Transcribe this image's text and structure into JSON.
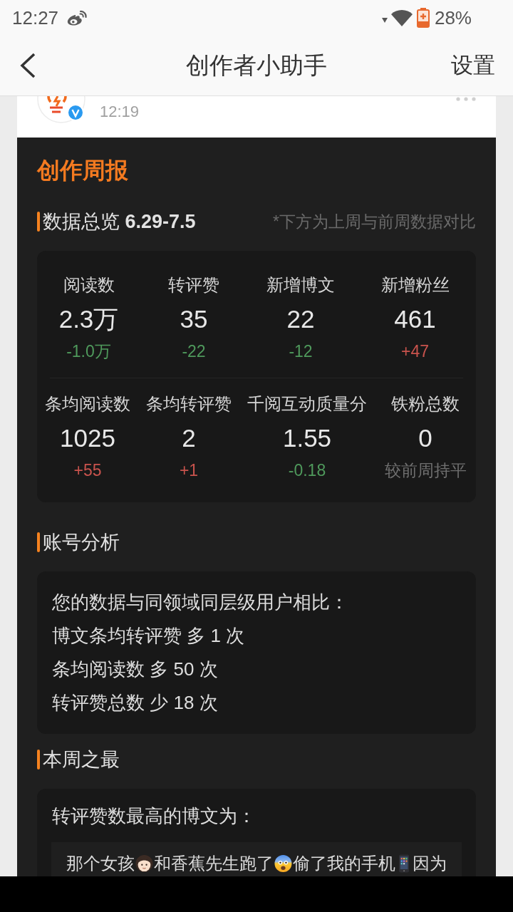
{
  "status_bar": {
    "time": "12:27",
    "battery": "28%"
  },
  "nav_bar": {
    "title": "创作者小助手",
    "action": "设置"
  },
  "post": {
    "time": "12:19"
  },
  "report": {
    "title": "创作周报",
    "overview": {
      "heading": "数据总览 **6.29-7.5**",
      "note": "*下方为上周与前周数据对比",
      "rows": [
        {
          "items": [
            {
              "label": "阅读数",
              "value": "2.3万",
              "change": "-1.0万",
              "color": "#4f9a5c"
            },
            {
              "label": "转评赞",
              "value": "35",
              "change": "-22",
              "color": "#4f9a5c"
            },
            {
              "label": "新增博文",
              "value": "22",
              "change": "-12",
              "color": "#4f9a5c"
            },
            {
              "label": "新增粉丝",
              "value": "461",
              "change": "+47",
              "color": "#c9534d"
            }
          ]
        },
        {
          "items": [
            {
              "label": "条均阅读数",
              "value": "1025",
              "change": "+55",
              "color": "#c9534d"
            },
            {
              "label": "条均转评赞",
              "value": "2",
              "change": "+1",
              "color": "#c9534d"
            },
            {
              "label": "千阅互动质量分",
              "value": "1.55",
              "change": "-0.18",
              "color": "#4f9a5c"
            },
            {
              "label": "铁粉总数",
              "value": "0",
              "change": "较前周持平",
              "color": "#6f6f6f"
            }
          ]
        }
      ]
    },
    "analysis": {
      "heading": "账号分析",
      "lines": [
        "您的数据与同领域同层级用户相比：",
        "博文条均转评赞 多 1 次",
        "条均阅读数 多 50 次",
        "转评赞总数 少 18 次"
      ]
    },
    "best": {
      "heading": "本周之最",
      "intro": "转评赞数最高的博文为：",
      "post_segments": [
        {
          "kind": "text",
          "text": "那个女孩"
        },
        {
          "kind": "girl"
        },
        {
          "kind": "text",
          "text": "和香蕉先生跑了"
        },
        {
          "kind": "scared"
        },
        {
          "kind": "text",
          "text": "偷了我的手机"
        },
        {
          "kind": "phone"
        },
        {
          "kind": "text",
          "text": "因为"
        }
      ]
    }
  }
}
